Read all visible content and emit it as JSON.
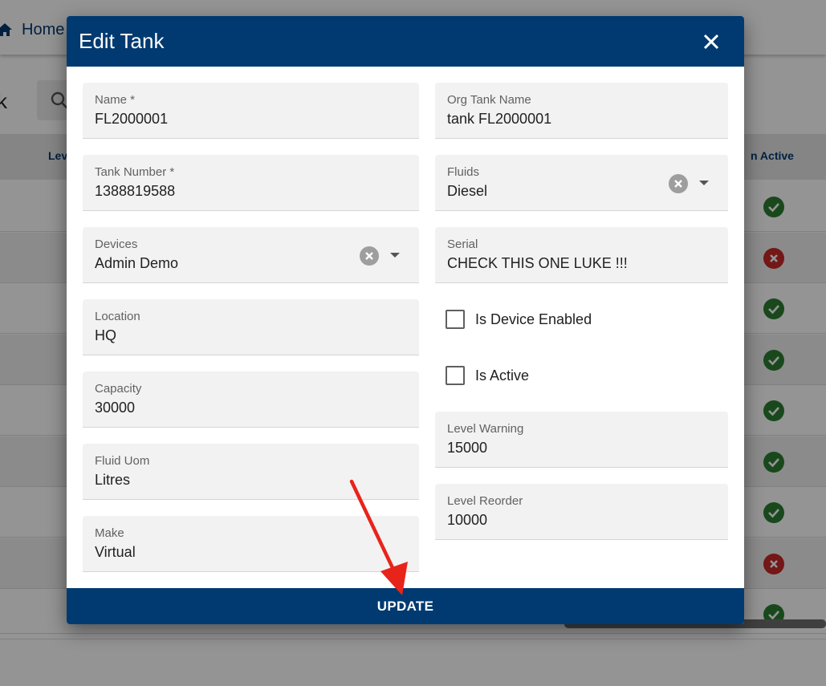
{
  "background": {
    "breadcrumb_home": "Home",
    "page_title_fragment": "k",
    "table_headers": {
      "level": "Lev",
      "active": "n Active"
    },
    "row_statuses": [
      "ok",
      "bad",
      "ok",
      "ok",
      "ok",
      "ok",
      "ok",
      "bad",
      "ok"
    ]
  },
  "dialog": {
    "title": "Edit Tank",
    "fields": {
      "name": {
        "label": "Name *",
        "value": "FL2000001"
      },
      "org_tank_name": {
        "label": "Org Tank Name",
        "value": "tank FL2000001"
      },
      "tank_number": {
        "label": "Tank Number *",
        "value": "1388819588"
      },
      "fluids": {
        "label": "Fluids",
        "value": "Diesel"
      },
      "devices": {
        "label": "Devices",
        "value": "Admin Demo"
      },
      "serial": {
        "label": "Serial",
        "value": "CHECK THIS ONE LUKE !!!"
      },
      "location": {
        "label": "Location",
        "value": "HQ"
      },
      "capacity": {
        "label": "Capacity",
        "value": "30000"
      },
      "fluid_uom": {
        "label": "Fluid Uom",
        "value": "Litres"
      },
      "make": {
        "label": "Make",
        "value": "Virtual"
      },
      "level_warning": {
        "label": "Level Warning",
        "value": "15000"
      },
      "level_reorder": {
        "label": "Level Reorder",
        "value": "10000"
      }
    },
    "checkboxes": {
      "is_device_enabled": {
        "label": "Is Device Enabled",
        "checked": false
      },
      "is_active": {
        "label": "Is Active",
        "checked": false
      }
    },
    "update_label": "UPDATE"
  },
  "colors": {
    "primary": "#003a70",
    "ok_status": "#2e7d32",
    "bad_status": "#c62828",
    "annotation_arrow": "#e8241a"
  }
}
